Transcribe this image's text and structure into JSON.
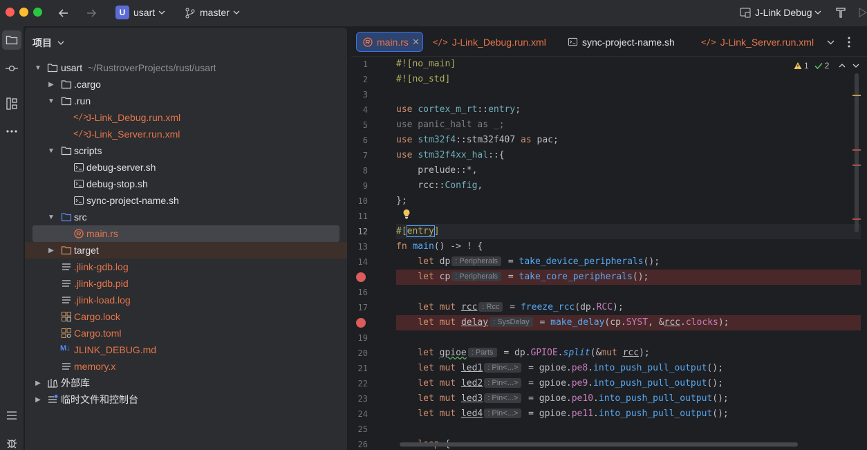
{
  "titlebar": {
    "project_badge": "U",
    "project_name": "usart",
    "branch": "master",
    "run_config": "J-Link Debug"
  },
  "project_panel": {
    "title": "项目",
    "root_name": "usart",
    "root_path": "~/RustroverProjects/rust/usart",
    "items": [
      {
        "label": ".cargo"
      },
      {
        "label": ".run"
      },
      {
        "label": "J-Link_Debug.run.xml"
      },
      {
        "label": "J-Link_Server.run.xml"
      },
      {
        "label": "scripts"
      },
      {
        "label": "debug-server.sh"
      },
      {
        "label": "debug-stop.sh"
      },
      {
        "label": "sync-project-name.sh"
      },
      {
        "label": "src"
      },
      {
        "label": "main.rs"
      },
      {
        "label": "target"
      },
      {
        "label": ".jlink-gdb.log"
      },
      {
        "label": ".jlink-gdb.pid"
      },
      {
        "label": ".jlink-load.log"
      },
      {
        "label": "Cargo.lock"
      },
      {
        "label": "Cargo.toml"
      },
      {
        "label": "JLINK_DEBUG.md"
      },
      {
        "label": "memory.x"
      },
      {
        "label": "外部库"
      },
      {
        "label": "临时文件和控制台"
      }
    ],
    "md_badge": "M↓"
  },
  "editor": {
    "tabs": [
      {
        "label": "main.rs"
      },
      {
        "label": "J-Link_Debug.run.xml"
      },
      {
        "label": "sync-project-name.sh"
      },
      {
        "label": "J-Link_Server.run.xml"
      }
    ],
    "warnings": "1",
    "checks": "2",
    "line_numbers": [
      "1",
      "2",
      "3",
      "4",
      "5",
      "6",
      "7",
      "8",
      "9",
      "10",
      "11",
      "12",
      "13",
      "14",
      "15",
      "16",
      "17",
      "18",
      "19",
      "20",
      "21",
      "22",
      "23",
      "24",
      "25",
      "26"
    ],
    "current_line": "12",
    "breakpoint_lines": [
      "15",
      "18"
    ],
    "code": {
      "l1": "#![no_main]",
      "l2": "#![no_std]",
      "l4_kw": "use",
      "l4_mod": "cortex_m_rt",
      "l4_sep": "::",
      "l4_item": "entry",
      "l4_end": ";",
      "l5": "use panic_halt as _;",
      "l6_kw": "use",
      "l6_mod": "stm32f4",
      "l6_sep": "::",
      "l6_item": "stm32f407",
      "l6_as": "as",
      "l6_alias": "pac;",
      "l7_kw": "use",
      "l7_mod": "stm32f4xx_hal",
      "l7_end": "::{",
      "l8": "    prelude::*,",
      "l9_a": "    rcc::",
      "l9_b": "Config",
      "l9_c": ",",
      "l10": "};",
      "l12_a": "#[",
      "l12_b": "entry",
      "l12_c": "]",
      "l13_kw": "fn",
      "l13_fn": "main",
      "l13_rest": "() -> ! {",
      "l14_kw": "let",
      "l14_var": "dp",
      "l14_hint": ": Peripherals",
      "l14_eq": " = ",
      "l14_fn": "take_device_peripherals",
      "l14_end": "();",
      "l15_kw": "let",
      "l15_var": "cp",
      "l15_hint": ": Peripherals",
      "l15_eq": " = ",
      "l15_fn": "take_core_peripherals",
      "l15_end": "();",
      "l17_kw": "let mut",
      "l17_var": "rcc",
      "l17_hint": ": Rcc",
      "l17_eq": " = ",
      "l17_fn": "freeze_rcc",
      "l17_a": "(dp.",
      "l17_f": "RCC",
      "l17_end": ");",
      "l18_kw": "let mut",
      "l18_var": "delay",
      "l18_hint": ": SysDelay",
      "l18_eq": " = ",
      "l18_fn": "make_delay",
      "l18_a": "(cp.",
      "l18_f1": "SYST",
      "l18_b": ", &",
      "l18_v": "rcc",
      "l18_c": ".",
      "l18_f2": "clocks",
      "l18_end": ");",
      "l20_kw": "let",
      "l20_var": "gpioe",
      "l20_hint": ": Parts",
      "l20_eq": " = dp.",
      "l20_f": "GPIOE",
      "l20_d": ".",
      "l20_fn": "split",
      "l20_a": "(&",
      "l20_mut": "mut",
      "l20_v": "rcc",
      "l20_end": ");",
      "l21_kw": "let mut",
      "l21_var": "led1",
      "l21_hint": ": Pin<...>",
      "l21_eq": " = gpioe.",
      "l21_f": "pe8",
      "l21_d": ".",
      "l21_fn": "into_push_pull_output",
      "l21_end": "();",
      "l22_kw": "let mut",
      "l22_var": "led2",
      "l22_hint": ": Pin<...>",
      "l22_eq": " = gpioe.",
      "l22_f": "pe9",
      "l22_d": ".",
      "l22_fn": "into_push_pull_output",
      "l22_end": "();",
      "l23_kw": "let mut",
      "l23_var": "led3",
      "l23_hint": ": Pin<...>",
      "l23_eq": " = gpioe.",
      "l23_f": "pe10",
      "l23_d": ".",
      "l23_fn": "into_push_pull_output",
      "l23_end": "();",
      "l24_kw": "let mut",
      "l24_var": "led4",
      "l24_hint": ": Pin<...>",
      "l24_eq": " = gpioe.",
      "l24_f": "pe11",
      "l24_d": ".",
      "l24_fn": "into_push_pull_output",
      "l24_end": "();",
      "l26_kw": "loop",
      "l26_end": " {"
    }
  },
  "colors": {
    "accent": "#3574f0",
    "breakpoint": "#db5c5c",
    "xml_file": "#e8754a"
  }
}
